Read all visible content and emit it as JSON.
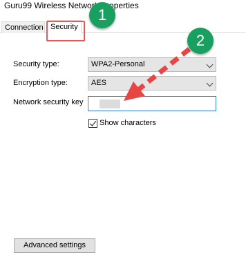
{
  "window": {
    "title": "Guru99 Wireless Network Properties"
  },
  "tabs": [
    {
      "label": "Connection"
    },
    {
      "label": "Security"
    }
  ],
  "form": {
    "security_type_label": "Security type:",
    "security_type_value": "WPA2-Personal",
    "encryption_type_label": "Encryption type:",
    "encryption_type_value": "AES",
    "network_key_label": "Network security key",
    "show_characters_label": "Show characters",
    "show_characters_checked": true
  },
  "buttons": {
    "advanced_settings": "Advanced settings"
  },
  "annotations": {
    "badge_1": "1",
    "badge_2": "2",
    "badge_color": "#19a060",
    "highlight_color": "#e35a5a",
    "arrow_color": "#e84545"
  }
}
